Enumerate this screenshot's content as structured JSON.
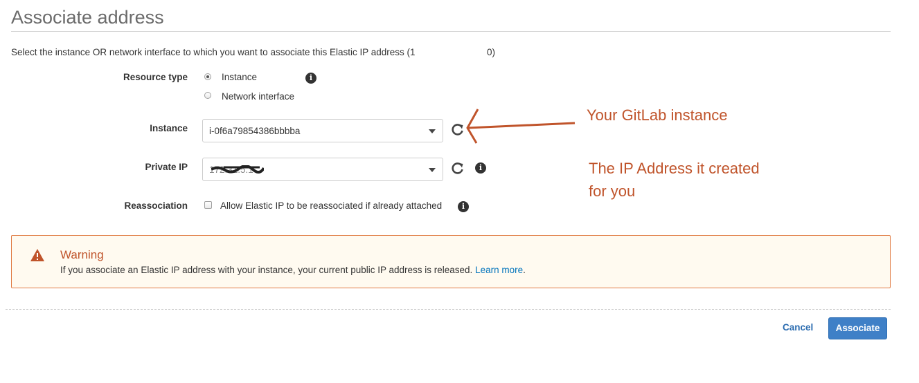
{
  "page": {
    "title": "Associate address",
    "description": "Select the instance OR network interface to which you want to associate this Elastic IP address (1",
    "description_tail": "0)"
  },
  "form": {
    "resource_type": {
      "label": "Resource type",
      "options": [
        {
          "label": "Instance",
          "selected": true
        },
        {
          "label": "Network interface",
          "selected": false
        }
      ]
    },
    "instance": {
      "label": "Instance",
      "value": "i-0f6a79854386bbbba"
    },
    "private_ip": {
      "label": "Private IP",
      "value": "172.31.5.1"
    },
    "reassociation": {
      "label": "Reassociation",
      "checkbox_label": "Allow Elastic IP to be reassociated if already attached",
      "checked": false
    }
  },
  "annotations": {
    "instance_note": "Your GitLab instance",
    "ip_note_line1": "The IP Address it created",
    "ip_note_line2": "for you",
    "color": "#c0542b"
  },
  "warning": {
    "title": "Warning",
    "text": "If you associate an Elastic IP address with your instance, your current public IP address is released.",
    "link": "Learn more",
    "link_suffix": ".",
    "icon": "warning-triangle-icon",
    "color": "#e07941"
  },
  "footer": {
    "cancel_label": "Cancel",
    "associate_label": "Associate",
    "primary_color": "#3f80c7"
  }
}
